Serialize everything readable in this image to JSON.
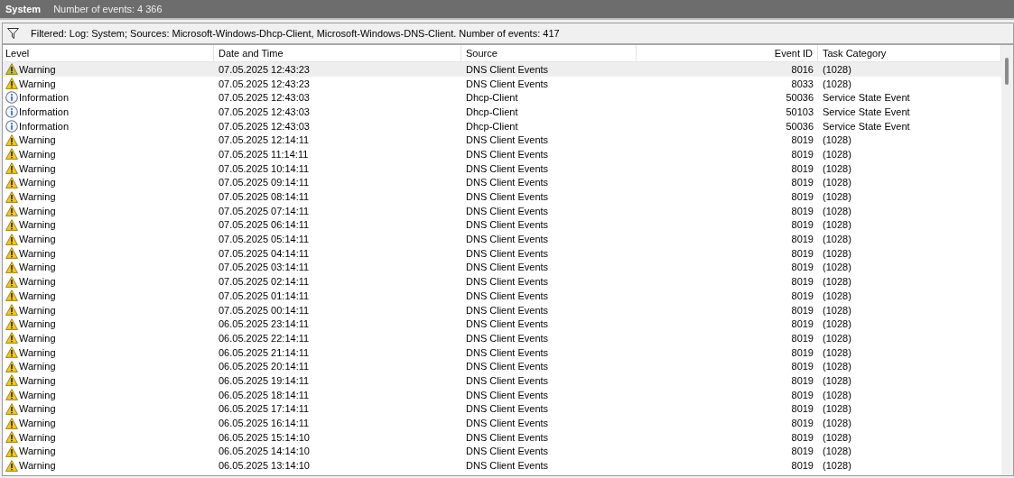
{
  "header": {
    "title": "System",
    "count": "Number of events: 4 366"
  },
  "filter": {
    "text": "Filtered: Log: System; Sources: Microsoft-Windows-Dhcp-Client, Microsoft-Windows-DNS-Client. Number of events: 417"
  },
  "table": {
    "columns": [
      "Level",
      "Date and Time",
      "Source",
      "Event ID",
      "Task Category"
    ],
    "rows": [
      {
        "kind": "warning",
        "level": "Warning",
        "date": "07.05.2025 12:43:23",
        "source": "DNS Client Events",
        "event_id": "8016",
        "category": "(1028)",
        "selected": true
      },
      {
        "kind": "warning",
        "level": "Warning",
        "date": "07.05.2025 12:43:23",
        "source": "DNS Client Events",
        "event_id": "8033",
        "category": "(1028)",
        "selected": false
      },
      {
        "kind": "information",
        "level": "Information",
        "date": "07.05.2025 12:43:03",
        "source": "Dhcp-Client",
        "event_id": "50036",
        "category": "Service State Event",
        "selected": false
      },
      {
        "kind": "information",
        "level": "Information",
        "date": "07.05.2025 12:43:03",
        "source": "Dhcp-Client",
        "event_id": "50103",
        "category": "Service State Event",
        "selected": false
      },
      {
        "kind": "information",
        "level": "Information",
        "date": "07.05.2025 12:43:03",
        "source": "Dhcp-Client",
        "event_id": "50036",
        "category": "Service State Event",
        "selected": false
      },
      {
        "kind": "warning",
        "level": "Warning",
        "date": "07.05.2025 12:14:11",
        "source": "DNS Client Events",
        "event_id": "8019",
        "category": "(1028)",
        "selected": false
      },
      {
        "kind": "warning",
        "level": "Warning",
        "date": "07.05.2025 11:14:11",
        "source": "DNS Client Events",
        "event_id": "8019",
        "category": "(1028)",
        "selected": false
      },
      {
        "kind": "warning",
        "level": "Warning",
        "date": "07.05.2025 10:14:11",
        "source": "DNS Client Events",
        "event_id": "8019",
        "category": "(1028)",
        "selected": false
      },
      {
        "kind": "warning",
        "level": "Warning",
        "date": "07.05.2025 09:14:11",
        "source": "DNS Client Events",
        "event_id": "8019",
        "category": "(1028)",
        "selected": false
      },
      {
        "kind": "warning",
        "level": "Warning",
        "date": "07.05.2025 08:14:11",
        "source": "DNS Client Events",
        "event_id": "8019",
        "category": "(1028)",
        "selected": false
      },
      {
        "kind": "warning",
        "level": "Warning",
        "date": "07.05.2025 07:14:11",
        "source": "DNS Client Events",
        "event_id": "8019",
        "category": "(1028)",
        "selected": false
      },
      {
        "kind": "warning",
        "level": "Warning",
        "date": "07.05.2025 06:14:11",
        "source": "DNS Client Events",
        "event_id": "8019",
        "category": "(1028)",
        "selected": false
      },
      {
        "kind": "warning",
        "level": "Warning",
        "date": "07.05.2025 05:14:11",
        "source": "DNS Client Events",
        "event_id": "8019",
        "category": "(1028)",
        "selected": false
      },
      {
        "kind": "warning",
        "level": "Warning",
        "date": "07.05.2025 04:14:11",
        "source": "DNS Client Events",
        "event_id": "8019",
        "category": "(1028)",
        "selected": false
      },
      {
        "kind": "warning",
        "level": "Warning",
        "date": "07.05.2025 03:14:11",
        "source": "DNS Client Events",
        "event_id": "8019",
        "category": "(1028)",
        "selected": false
      },
      {
        "kind": "warning",
        "level": "Warning",
        "date": "07.05.2025 02:14:11",
        "source": "DNS Client Events",
        "event_id": "8019",
        "category": "(1028)",
        "selected": false
      },
      {
        "kind": "warning",
        "level": "Warning",
        "date": "07.05.2025 01:14:11",
        "source": "DNS Client Events",
        "event_id": "8019",
        "category": "(1028)",
        "selected": false
      },
      {
        "kind": "warning",
        "level": "Warning",
        "date": "07.05.2025 00:14:11",
        "source": "DNS Client Events",
        "event_id": "8019",
        "category": "(1028)",
        "selected": false
      },
      {
        "kind": "warning",
        "level": "Warning",
        "date": "06.05.2025 23:14:11",
        "source": "DNS Client Events",
        "event_id": "8019",
        "category": "(1028)",
        "selected": false
      },
      {
        "kind": "warning",
        "level": "Warning",
        "date": "06.05.2025 22:14:11",
        "source": "DNS Client Events",
        "event_id": "8019",
        "category": "(1028)",
        "selected": false
      },
      {
        "kind": "warning",
        "level": "Warning",
        "date": "06.05.2025 21:14:11",
        "source": "DNS Client Events",
        "event_id": "8019",
        "category": "(1028)",
        "selected": false
      },
      {
        "kind": "warning",
        "level": "Warning",
        "date": "06.05.2025 20:14:11",
        "source": "DNS Client Events",
        "event_id": "8019",
        "category": "(1028)",
        "selected": false
      },
      {
        "kind": "warning",
        "level": "Warning",
        "date": "06.05.2025 19:14:11",
        "source": "DNS Client Events",
        "event_id": "8019",
        "category": "(1028)",
        "selected": false
      },
      {
        "kind": "warning",
        "level": "Warning",
        "date": "06.05.2025 18:14:11",
        "source": "DNS Client Events",
        "event_id": "8019",
        "category": "(1028)",
        "selected": false
      },
      {
        "kind": "warning",
        "level": "Warning",
        "date": "06.05.2025 17:14:11",
        "source": "DNS Client Events",
        "event_id": "8019",
        "category": "(1028)",
        "selected": false
      },
      {
        "kind": "warning",
        "level": "Warning",
        "date": "06.05.2025 16:14:11",
        "source": "DNS Client Events",
        "event_id": "8019",
        "category": "(1028)",
        "selected": false
      },
      {
        "kind": "warning",
        "level": "Warning",
        "date": "06.05.2025 15:14:10",
        "source": "DNS Client Events",
        "event_id": "8019",
        "category": "(1028)",
        "selected": false
      },
      {
        "kind": "warning",
        "level": "Warning",
        "date": "06.05.2025 14:14:10",
        "source": "DNS Client Events",
        "event_id": "8019",
        "category": "(1028)",
        "selected": false
      },
      {
        "kind": "warning",
        "level": "Warning",
        "date": "06.05.2025 13:14:10",
        "source": "DNS Client Events",
        "event_id": "8019",
        "category": "(1028)",
        "selected": false
      }
    ]
  }
}
